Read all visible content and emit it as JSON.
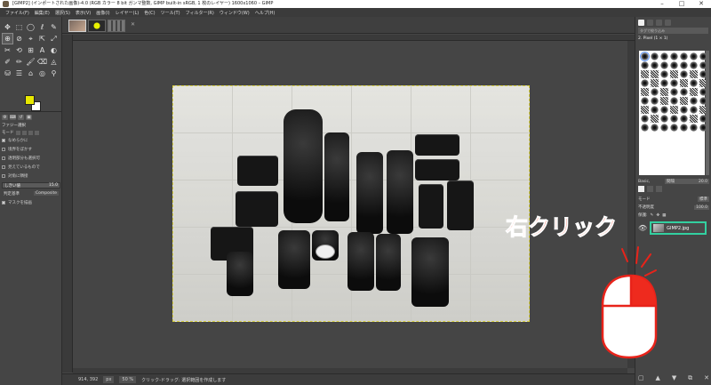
{
  "window": {
    "title": "[GIMP2] (インポートされた画像)-4.0 (RGB カラー 8 bit ガンマ整数, GIMP built-in sRGB, 1 枚のレイヤー) 1600x1060 – GIMP",
    "controls": [
      "–",
      "□",
      "✕"
    ]
  },
  "menu": {
    "items": [
      "ファイル(F)",
      "編集(E)",
      "選択(S)",
      "表示(V)",
      "画像(I)",
      "レイヤー(L)",
      "色(C)",
      "ツール(T)",
      "フィルター(R)",
      "ウィンドウ(W)",
      "ヘルプ(H)"
    ]
  },
  "toolbox": {
    "tools": [
      "✥",
      "⬚",
      "◯",
      "ℓ",
      "✎",
      "⊕",
      "⊘",
      "⌖",
      "⇱",
      "⤢",
      "✂",
      "⟲",
      "⊞",
      "A",
      "◐",
      "✐",
      "✏",
      "🖌",
      "⌫",
      "◬",
      "⛁",
      "☰",
      "⌂",
      "◎",
      "⚲"
    ],
    "active_index": 5
  },
  "tool_options": {
    "title": "ファジー選択",
    "mode_label": "モード",
    "checkboxes": [
      {
        "label": "なめらかに",
        "checked": true
      },
      {
        "label": "境界をぼかす",
        "checked": false
      },
      {
        "label": "透明部分も選択可",
        "checked": false
      },
      {
        "label": "見えているもので",
        "checked": false
      },
      {
        "label": "対角に隣接",
        "checked": false
      }
    ],
    "threshold_label": "しきい値",
    "threshold_value": "15.0",
    "criterion_label": "判定基準",
    "criterion_value": "Composite",
    "mask_label": "マスクを描画",
    "mask_checked": true
  },
  "image_tabs": {
    "close": "✕"
  },
  "status": {
    "coords": "914, 392",
    "unit": "px",
    "zoom": "50 %",
    "message": "クリック-ドラッグ: 選択範囲を作成します"
  },
  "dock": {
    "filter_placeholder": "タグで絞り込み",
    "brush_name": "2. Pixel (1 × 1)",
    "brush_preset_label": "Basic,",
    "spacing_label": "間隔",
    "spacing_value": "20.0",
    "mode_label": "モード",
    "mode_value": "標準",
    "opacity_label": "不透明度",
    "opacity_value": "100.0",
    "lock_label": "保護:",
    "layer_name": "GIMP2.jpg",
    "eye_icon": "👁"
  },
  "annotation": {
    "text": "右クリック",
    "color": "#ff2b12"
  }
}
